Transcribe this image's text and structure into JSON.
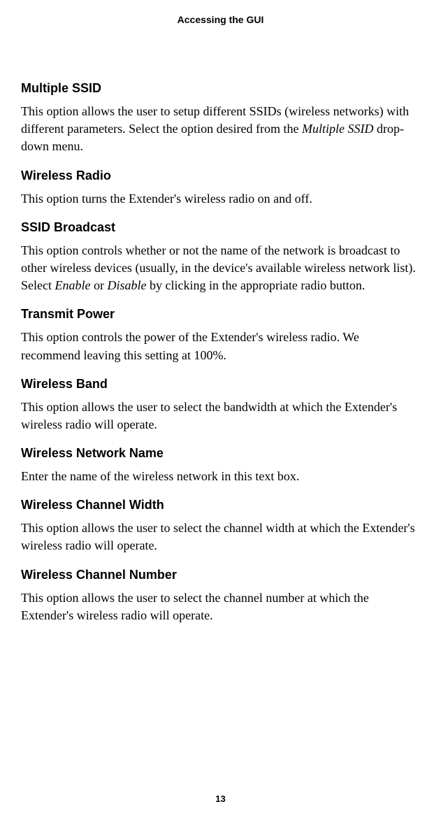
{
  "header": "Accessing the GUI",
  "pageNumber": "13",
  "sections": [
    {
      "heading": "Multiple SSID",
      "body_pre": "This option allows the user to setup different SSIDs (wireless networks) with different parameters. Select the option desired from the ",
      "body_italic": "Multiple SSID",
      "body_post": " drop-down menu."
    },
    {
      "heading": "Wireless Radio",
      "body": "This option turns the Extender's wireless radio on and off."
    },
    {
      "heading": "SSID Broadcast",
      "body_pre": "This option controls whether or not the name of the network is broadcast to other wireless devices (usually, in the device's available wireless network list). Select ",
      "body_italic1": "Enable",
      "body_mid": " or ",
      "body_italic2": "Disable",
      "body_post": " by clicking in the appropriate radio button."
    },
    {
      "heading": "Transmit Power",
      "body": "This option controls the power of the Extender's wireless radio. We recommend leaving this setting at 100%."
    },
    {
      "heading": "Wireless Band",
      "body": "This option allows the user to select the bandwidth at which the Extender's wireless radio will operate."
    },
    {
      "heading": "Wireless Network Name",
      "body": "Enter the name of the wireless network in this text box."
    },
    {
      "heading": "Wireless Channel Width",
      "body": "This option allows the user to select the channel width at which the Extender's wireless radio will operate."
    },
    {
      "heading": "Wireless Channel Number",
      "body": "This option allows the user to select the channel number at which the Extender's wireless radio will operate."
    }
  ]
}
